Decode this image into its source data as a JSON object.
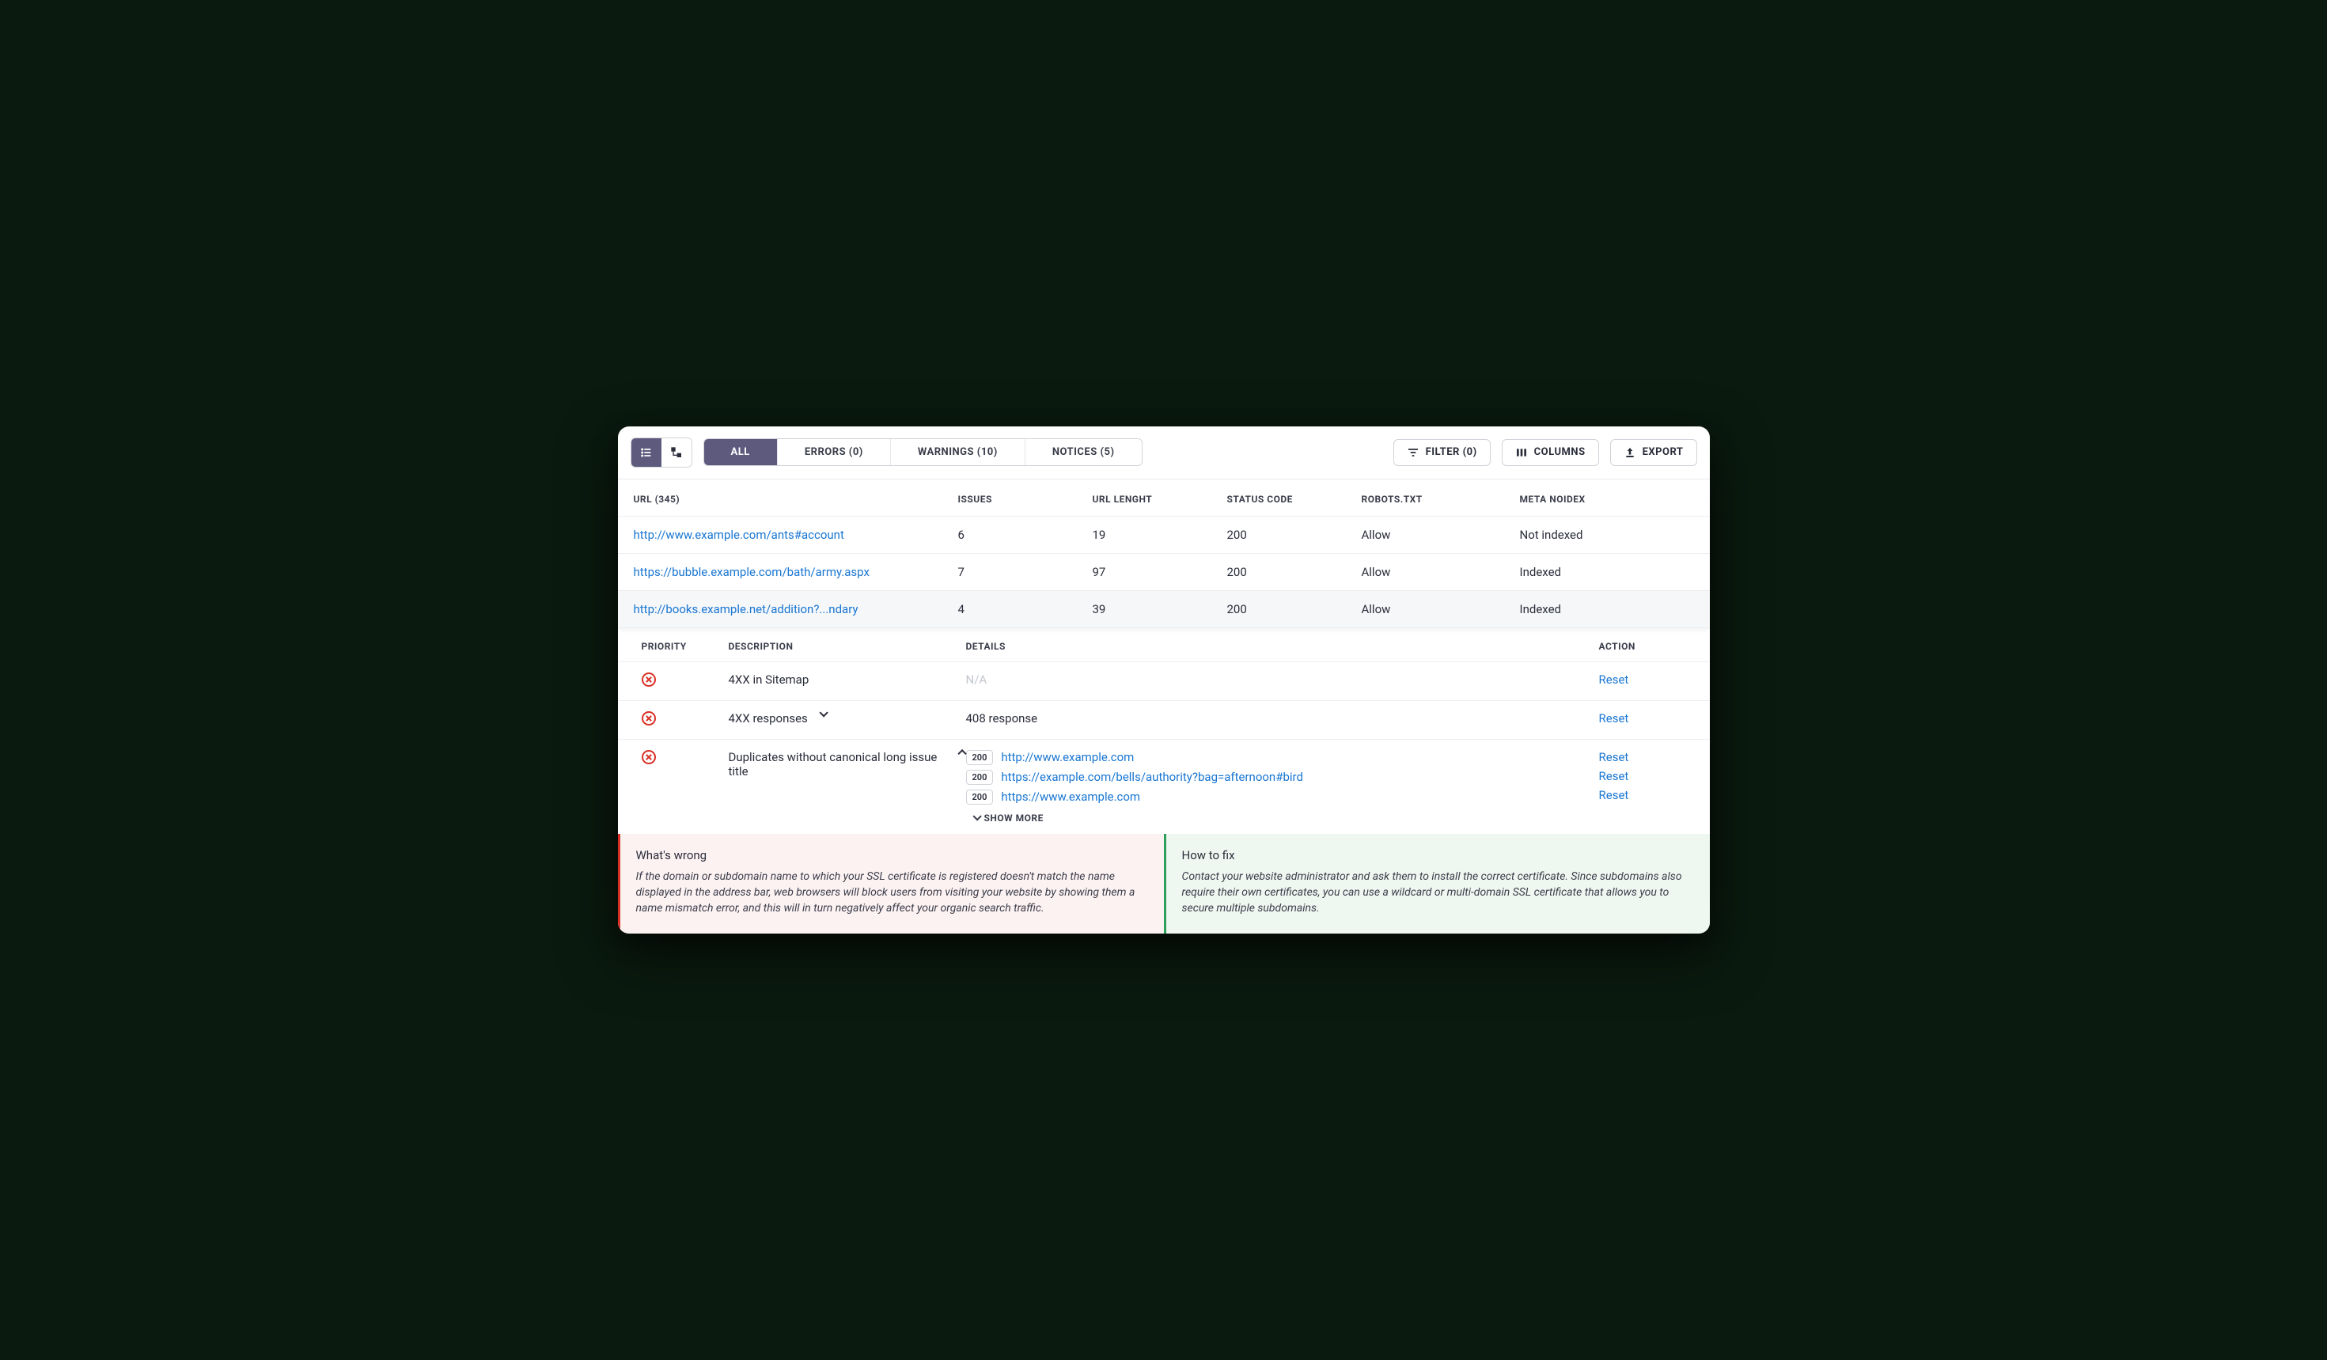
{
  "toolbar": {
    "tabs": [
      {
        "label": "ALL",
        "active": true
      },
      {
        "label": "ERRORS (0)",
        "active": false
      },
      {
        "label": "WARNINGS (10)",
        "active": false
      },
      {
        "label": "NOTICES (5)",
        "active": false
      }
    ],
    "filter_label": "FILTER (0)",
    "columns_label": "COLUMNS",
    "export_label": "EXPORT"
  },
  "columns": {
    "url": "URL (345)",
    "issues": "ISSUES",
    "url_length": "URL LENGHT",
    "status_code": "STATUS CODE",
    "robots": "ROBOTS.TXT",
    "meta_noindex": "META NOIDEX"
  },
  "rows": [
    {
      "url": "http://www.example.com/ants#account",
      "issues": "6",
      "url_length": "19",
      "status": "200",
      "robots": "Allow",
      "meta": "Not indexed",
      "selected": false
    },
    {
      "url": "https://bubble.example.com/bath/army.aspx",
      "issues": "7",
      "url_length": "97",
      "status": "200",
      "robots": "Allow",
      "meta": "Indexed",
      "selected": false
    },
    {
      "url": "http://books.example.net/addition?...ndary",
      "issues": "4",
      "url_length": "39",
      "status": "200",
      "robots": "Allow",
      "meta": "Indexed",
      "selected": true
    }
  ],
  "sub_columns": {
    "priority": "PRIORITY",
    "description": "DESCRIPTION",
    "details": "DETAILS",
    "action": "ACTION"
  },
  "issues": [
    {
      "description": "4XX in Sitemap",
      "expand": "none",
      "details_na": "N/A",
      "action": "Reset"
    },
    {
      "description": "4XX responses",
      "expand": "down",
      "details_text": "408 response",
      "action": "Reset"
    },
    {
      "description": "Duplicates without canonical long issue title",
      "expand": "up",
      "detail_links": [
        {
          "badge": "200",
          "url": "http://www.example.com",
          "action": "Reset"
        },
        {
          "badge": "200",
          "url": "https://example.com/bells/authority?bag=afternoon#bird",
          "action": "Reset"
        },
        {
          "badge": "200",
          "url": "https://www.example.com",
          "action": "Reset"
        }
      ],
      "show_more": "SHOW MORE"
    }
  ],
  "panels": {
    "wrong_title": "What's wrong",
    "wrong_body": "If the domain or subdomain name to which your SSL certificate is registered doesn't match the name displayed in the address bar, web browsers will block users from visiting your website by showing them a name mismatch error, and this will in turn negatively affect your organic search traffic.",
    "fix_title": "How to fix",
    "fix_body": "Contact your website administrator and ask them to install the correct certificate. Since subdomains also require their own certificates, you can use a wildcard or multi-domain SSL certificate that allows you to secure multiple subdomains."
  }
}
